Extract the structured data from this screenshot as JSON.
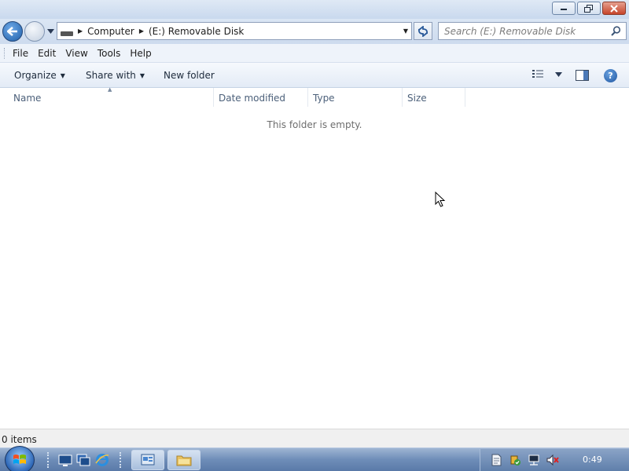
{
  "window": {
    "buttons": {
      "minimize": "minimize",
      "restore": "restore",
      "close": "close"
    }
  },
  "navigation": {
    "breadcrumbs": [
      "Computer",
      "(E:) Removable Disk"
    ],
    "search_placeholder": "Search (E:) Removable Disk"
  },
  "menubar": {
    "items": [
      "File",
      "Edit",
      "View",
      "Tools",
      "Help"
    ]
  },
  "commandbar": {
    "organize": "Organize",
    "share_with": "Share with",
    "new_folder": "New folder"
  },
  "columns": {
    "name": "Name",
    "date_modified": "Date modified",
    "type": "Type",
    "size": "Size"
  },
  "content": {
    "empty_message": "This folder is empty."
  },
  "statusbar": {
    "items_count": "0 items"
  },
  "taskbar": {
    "clock": "0:49"
  },
  "icons": {
    "back": "back-arrow-icon",
    "forward": "forward-arrow-icon",
    "refresh": "refresh-icon",
    "search": "search-icon",
    "help": "help-icon",
    "drive": "removable-drive-icon"
  }
}
